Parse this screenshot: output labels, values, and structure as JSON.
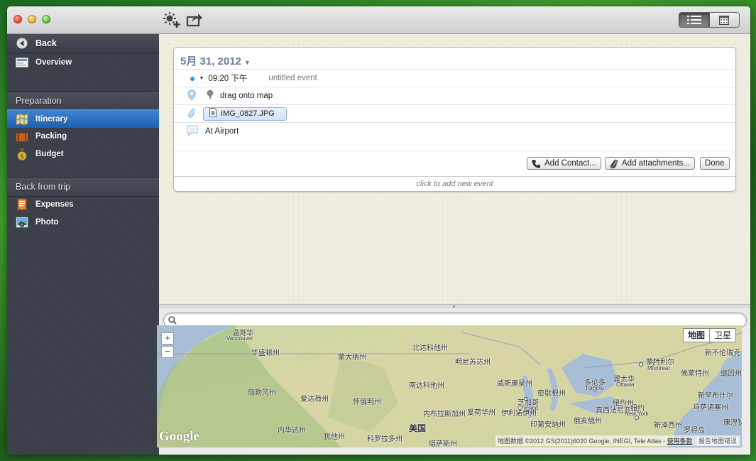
{
  "sidebar": {
    "back_label": "Back",
    "overview_label": "Overview",
    "section_preparation": "Preparation",
    "section_back": "Back from trip",
    "items": [
      {
        "label": "Itinerary",
        "icon": "map-icon"
      },
      {
        "label": "Packing",
        "icon": "suitcase-icon"
      },
      {
        "label": "Budget",
        "icon": "money-bag-icon"
      },
      {
        "label": "Expenses",
        "icon": "receipt-icon"
      },
      {
        "label": "Photo",
        "icon": "photo-icon"
      }
    ]
  },
  "event": {
    "date": "5月 31, 2012",
    "time": "09:20 下午",
    "title": "untitled event",
    "location": "drag onto map",
    "attachment": "IMG_0827.JPG",
    "note": "At Airport",
    "add_contact_label": "Add Contact...",
    "add_attachments_label": "Add attachments...",
    "done_label": "Done",
    "add_new_label": "click to add new event"
  },
  "search": {
    "value": "",
    "placeholder": ""
  },
  "map": {
    "type_map": "地图",
    "type_satellite": "卫星",
    "zoom_in": "+",
    "zoom_out": "−",
    "logo": "Google",
    "attribution": "地图数据 ©2012 GS(2011)6020 Google, INEGI, Tele Atlas - ",
    "terms": "使用条款",
    "report": "报告地图错误",
    "labels": [
      {
        "text": "温哥华"
      },
      {
        "text": "Vancouver"
      },
      {
        "text": "华盛顿州"
      },
      {
        "text": "蒙大纳州"
      },
      {
        "text": "北达科他州"
      },
      {
        "text": "明尼苏达州"
      },
      {
        "text": "南达科他州"
      },
      {
        "text": "威斯康星州"
      },
      {
        "text": "蒙特利尔"
      },
      {
        "text": "Montreal"
      },
      {
        "text": "佛蒙特州"
      },
      {
        "text": "缅因州"
      },
      {
        "text": "新不伦瑞克"
      },
      {
        "text": "俄勒冈州"
      },
      {
        "text": "爱达荷州"
      },
      {
        "text": "怀俄明州"
      },
      {
        "text": "内布拉斯加州"
      },
      {
        "text": "爱荷华州"
      },
      {
        "text": "密歇根州"
      },
      {
        "text": "多伦多"
      },
      {
        "text": "Toronto"
      },
      {
        "text": "渥太华"
      },
      {
        "text": "Ottawa"
      },
      {
        "text": "纽约州"
      },
      {
        "text": "新罕布什尔"
      },
      {
        "text": "马萨诸塞州"
      },
      {
        "text": "芝加哥"
      },
      {
        "text": "Chicago"
      },
      {
        "text": "伊利诺伊州"
      },
      {
        "text": "印第安纳州"
      },
      {
        "text": "俄亥俄州"
      },
      {
        "text": "宾西法尼亚州"
      },
      {
        "text": "纽约"
      },
      {
        "text": "New York"
      },
      {
        "text": "新泽西州"
      },
      {
        "text": "罗得岛"
      },
      {
        "text": "内华达州"
      },
      {
        "text": "犹他州"
      },
      {
        "text": "科罗拉多州"
      },
      {
        "text": "堪萨斯州"
      },
      {
        "text": "美国"
      },
      {
        "text": "康涅狄格"
      }
    ]
  },
  "colors": {
    "accent": "#1c5fb1",
    "date_text": "#6a7ca0",
    "sidebar_bg": "#3b3f4a",
    "map_water": "#a7bed6",
    "event_dot": "#1a9ce0"
  }
}
